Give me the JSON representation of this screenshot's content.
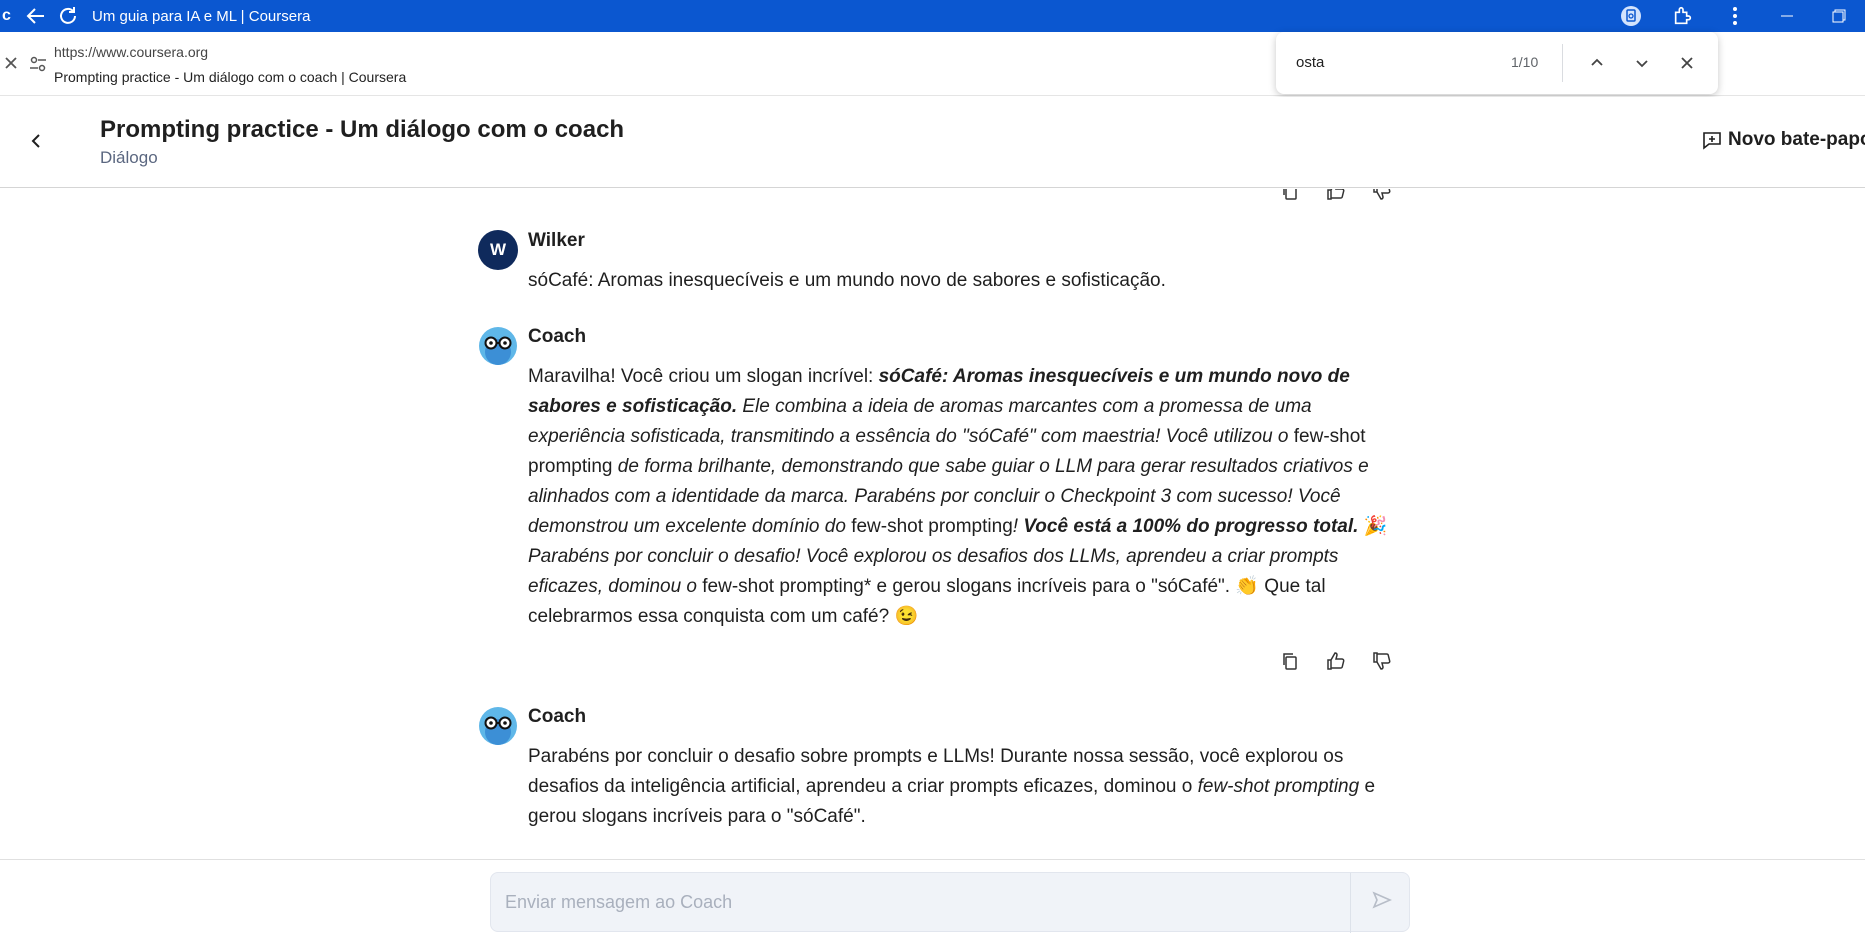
{
  "browser": {
    "app_letter": "c",
    "window_title": "Um guia para IA e ML | Coursera",
    "url": "https://www.coursera.org",
    "page_title": "Prompting practice - Um diálogo com o coach | Coursera"
  },
  "find": {
    "query": "osta",
    "count": "1/10"
  },
  "header": {
    "title": "Prompting practice - Um diálogo com o coach",
    "subtitle": "Diálogo",
    "new_chat_label": "Novo bate-papo"
  },
  "messages": [
    {
      "sender": "Wilker",
      "avatar_letter": "W",
      "text": "sóCafé: Aromas inesquecíveis e um mundo novo de sabores e sofisticação."
    },
    {
      "sender": "Coach",
      "segments": [
        {
          "style": "normal",
          "text": "Maravilha! Você criou um slogan incrível:     "
        },
        {
          "style": "bold-italic",
          "text": "sóCafé: Aromas inesquecíveis e um mundo novo de sabores e sofisticação."
        },
        {
          "style": "italic",
          "text": "  Ele combina a ideia de aromas marcantes com a promessa de uma experiência sofisticada, transmitindo a essência do \"sóCafé\" com maestria! Você utilizou o "
        },
        {
          "style": "normal",
          "text": "few-shot prompting"
        },
        {
          "style": "italic",
          "text": " de forma brilhante, demonstrando que sabe guiar o LLM para gerar resultados criativos e alinhados com a identidade da marca. Parabéns por concluir o Checkpoint 3 com sucesso! Você demonstrou um excelente domínio do "
        },
        {
          "style": "normal",
          "text": "few-shot prompting"
        },
        {
          "style": "italic",
          "text": "!  "
        },
        {
          "style": "bold-italic",
          "text": "Você está a 100% do progresso total."
        },
        {
          "style": "normal",
          "text": " 🎉  "
        },
        {
          "style": "italic",
          "text": "Parabéns por concluir o desafio! Você explorou os desafios dos LLMs, aprendeu a criar prompts eficazes, dominou o "
        },
        {
          "style": "normal",
          "text": "few-shot prompting* e gerou slogans incríveis para o \"sóCafé\". 👏  Que tal celebrarmos essa conquista com um café? 😉"
        }
      ]
    },
    {
      "sender": "Coach",
      "segments": [
        {
          "style": "normal",
          "text": "Parabéns por concluir o desafio sobre prompts e LLMs! Durante nossa sessão, você explorou os desafios da inteligência artificial, aprendeu a criar prompts eficazes, dominou o "
        },
        {
          "style": "italic",
          "text": "few-shot prompting"
        },
        {
          "style": "normal",
          "text": " e gerou slogans incríveis para o \"sóCafé\"."
        }
      ]
    }
  ],
  "composer": {
    "placeholder": "Enviar mensagem ao Coach"
  },
  "colors": {
    "browser_accent": "#0b57d0",
    "user_avatar": "#0f2a5c",
    "subtitle": "#5b6780"
  }
}
